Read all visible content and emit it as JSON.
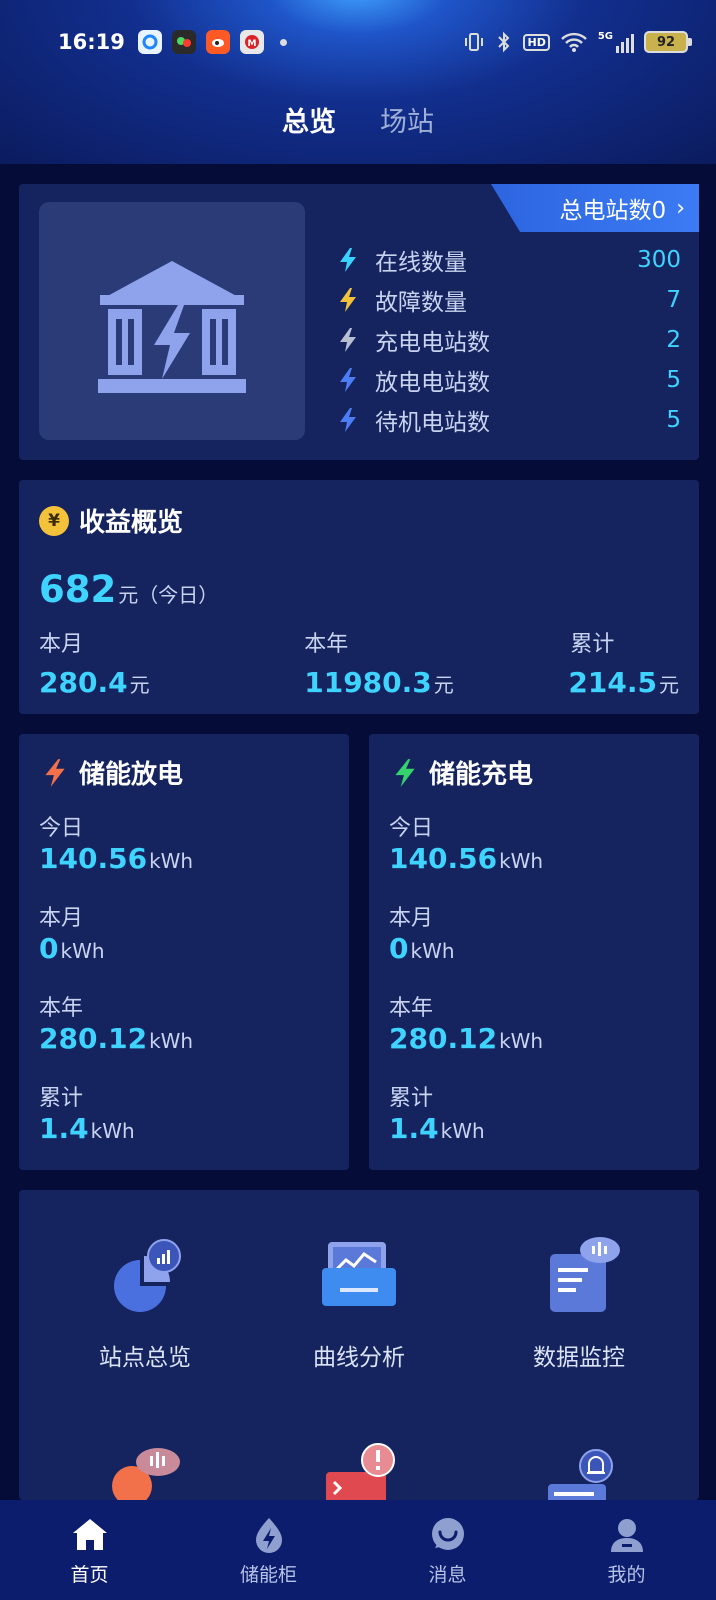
{
  "status_bar": {
    "time": "16:19",
    "battery": "92",
    "network": "5G",
    "hd": "HD"
  },
  "header": {
    "tabs": [
      {
        "label": "总览",
        "active": true
      },
      {
        "label": "场站",
        "active": false
      }
    ]
  },
  "station": {
    "total_label": "总电站数0",
    "stats": [
      {
        "label": "在线数量",
        "value": "300",
        "icon": "bolt-icon",
        "color": "#3ad3ff"
      },
      {
        "label": "故障数量",
        "value": "7",
        "icon": "bolt-icon",
        "color": "#f3c23a"
      },
      {
        "label": "充电电站数",
        "value": "2",
        "icon": "bolt-icon",
        "color": "#b8bfd3"
      },
      {
        "label": "放电电站数",
        "value": "5",
        "icon": "bolt-icon",
        "color": "#4d7df5"
      },
      {
        "label": "待机电站数",
        "value": "5",
        "icon": "bolt-icon",
        "color": "#4d7df5"
      }
    ]
  },
  "income": {
    "title": "收益概览",
    "yen_symbol": "¥",
    "today_value": "682",
    "unit": "元",
    "today_note": "（今日）",
    "cols": [
      {
        "label": "本月",
        "value": "280.4"
      },
      {
        "label": "本年",
        "value": "11980.3"
      },
      {
        "label": "累计",
        "value": "214.5"
      }
    ]
  },
  "discharge": {
    "title": "储能放电",
    "unit": "kWh",
    "rows": [
      {
        "label": "今日",
        "value": "140.56"
      },
      {
        "label": "本月",
        "value": "0"
      },
      {
        "label": "本年",
        "value": "280.12"
      },
      {
        "label": "累计",
        "value": "1.4"
      }
    ]
  },
  "charge": {
    "title": "储能充电",
    "unit": "kWh",
    "rows": [
      {
        "label": "今日",
        "value": "140.56"
      },
      {
        "label": "本月",
        "value": "0"
      },
      {
        "label": "本年",
        "value": "280.12"
      },
      {
        "label": "累计",
        "value": "1.4"
      }
    ]
  },
  "menu": {
    "items": [
      {
        "label": "站点总览",
        "icon": "pie-chart-icon"
      },
      {
        "label": "曲线分析",
        "icon": "line-chart-icon"
      },
      {
        "label": "数据监控",
        "icon": "data-monitor-icon"
      }
    ]
  },
  "bottom_nav": {
    "items": [
      {
        "label": "首页",
        "icon": "home-icon",
        "active": true
      },
      {
        "label": "储能柜",
        "icon": "energy-cabinet-icon",
        "active": false
      },
      {
        "label": "消息",
        "icon": "message-icon",
        "active": false
      },
      {
        "label": "我的",
        "icon": "user-icon",
        "active": false
      }
    ]
  }
}
